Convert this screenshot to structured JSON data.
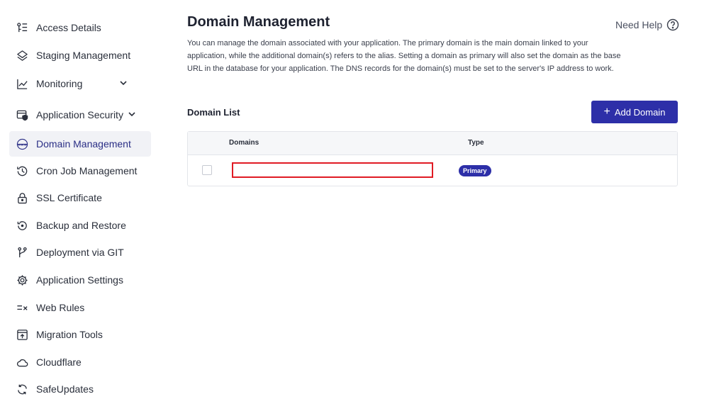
{
  "sidebar": {
    "items": [
      {
        "label": "Access Details",
        "icon": "access-details-icon",
        "active": false,
        "expandable": false
      },
      {
        "label": "Staging Management",
        "icon": "layers-icon",
        "active": false,
        "expandable": false
      },
      {
        "label": "Monitoring",
        "icon": "chart-line-icon",
        "active": false,
        "expandable": true
      },
      {
        "label": "Application Security",
        "icon": "shield-window-icon",
        "active": false,
        "expandable": true
      },
      {
        "label": "Domain Management",
        "icon": "www-globe-icon",
        "active": true,
        "expandable": false
      },
      {
        "label": "Cron Job Management",
        "icon": "clock-history-icon",
        "active": false,
        "expandable": false
      },
      {
        "label": "SSL Certificate",
        "icon": "lock-icon",
        "active": false,
        "expandable": false
      },
      {
        "label": "Backup and Restore",
        "icon": "restore-icon",
        "active": false,
        "expandable": false
      },
      {
        "label": "Deployment via GIT",
        "icon": "git-branch-icon",
        "active": false,
        "expandable": false
      },
      {
        "label": "Application Settings",
        "icon": "gear-icon",
        "active": false,
        "expandable": false
      },
      {
        "label": "Web Rules",
        "icon": "web-rules-icon",
        "active": false,
        "expandable": false
      },
      {
        "label": "Migration Tools",
        "icon": "migration-icon",
        "active": false,
        "expandable": false
      },
      {
        "label": "Cloudflare",
        "icon": "cloud-icon",
        "active": false,
        "expandable": false
      },
      {
        "label": "SafeUpdates",
        "icon": "refresh-icon",
        "active": false,
        "expandable": false
      }
    ]
  },
  "header": {
    "title": "Domain Management",
    "help_label": "Need Help",
    "description": "You can manage the domain associated with your application. The primary domain is the main domain linked to your application, while the additional domain(s) refers to the alias. Setting a domain as primary will also set the domain as the base URL in the database for your application. The DNS records for the domain(s) must be set to the server's IP address to work."
  },
  "domain_list": {
    "title": "Domain List",
    "add_button_label": "Add Domain",
    "columns": [
      "Domains",
      "Type"
    ],
    "rows": [
      {
        "domain": "",
        "type": "Primary",
        "selected": false
      }
    ]
  },
  "colors": {
    "accent": "#2d2fa8",
    "redaction_border": "#e01b24",
    "active_nav_bg": "#f1f2f6"
  }
}
